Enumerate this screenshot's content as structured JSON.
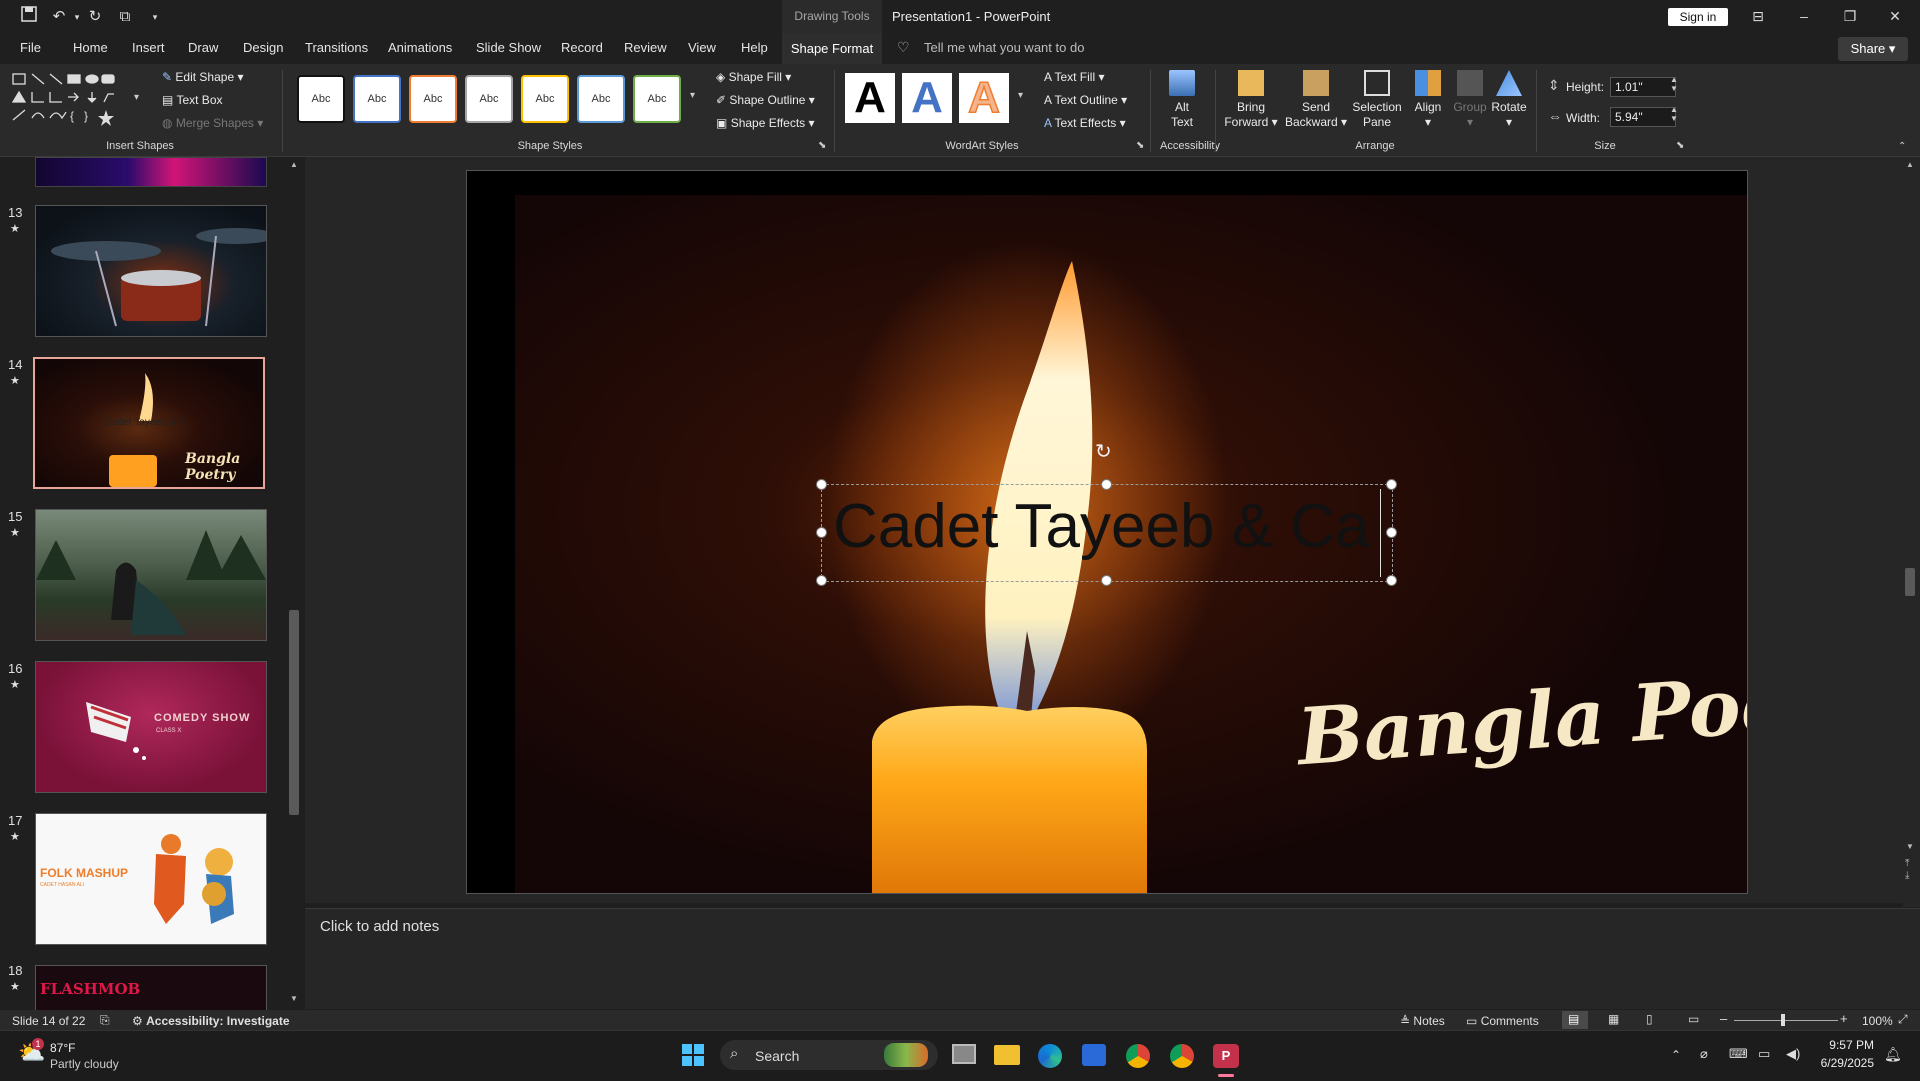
{
  "app": {
    "title": "Presentation1  -  PowerPoint",
    "drawing_tools": "Drawing Tools",
    "sign_in": "Sign in",
    "share": "Share"
  },
  "tabs": [
    "File",
    "Home",
    "Insert",
    "Draw",
    "Design",
    "Transitions",
    "Animations",
    "Slide Show",
    "Record",
    "Review",
    "View",
    "Help"
  ],
  "active_tab": "Shape Format",
  "tell_me": "Tell me what you want to do",
  "ribbon": {
    "insert_shapes": {
      "label": "Insert Shapes",
      "edit_shape": "Edit Shape",
      "text_box": "Text Box",
      "merge_shapes": "Merge Shapes"
    },
    "shape_styles": {
      "label": "Shape Styles",
      "swatch": "Abc",
      "fill": "Shape Fill",
      "outline": "Shape Outline",
      "effects": "Shape Effects"
    },
    "wordart": {
      "label": "WordArt Styles",
      "letter": "A",
      "fill": "Text Fill",
      "outline": "Text Outline",
      "effects": "Text Effects"
    },
    "accessibility": {
      "label": "Accessibility",
      "alt_text_1": "Alt",
      "alt_text_2": "Text"
    },
    "arrange": {
      "label": "Arrange",
      "bring_1": "Bring",
      "bring_2": "Forward",
      "send_1": "Send",
      "send_2": "Backward",
      "sel_1": "Selection",
      "sel_2": "Pane",
      "align": "Align",
      "group": "Group",
      "rotate": "Rotate"
    },
    "size": {
      "label": "Size",
      "height_label": "Height:",
      "height": "1.01\"",
      "width_label": "Width:",
      "width": "5.94\""
    }
  },
  "slides": [
    {
      "num": "13",
      "star": "★"
    },
    {
      "num": "14",
      "star": "★",
      "title": "Cadet Tayeeb & C",
      "sub": "Bangla Poetry"
    },
    {
      "num": "15",
      "star": "★"
    },
    {
      "num": "16",
      "star": "★",
      "title": "COMEDY SHOW",
      "sub": "CLASS X"
    },
    {
      "num": "17",
      "star": "★",
      "title": "FOLK MASHUP",
      "sub": "CADET HASAN ALI"
    },
    {
      "num": "18",
      "star": "★",
      "title": "FLASHMOB"
    }
  ],
  "slide": {
    "text_box": "Cadet Tayeeb & Ca",
    "script_title": "Bangla Poetry"
  },
  "notes_placeholder": "Click to add notes",
  "status": {
    "slide_of": "Slide 14 of 22",
    "accessibility": "Accessibility: Investigate",
    "notes": "Notes",
    "comments": "Comments",
    "zoom": "100%"
  },
  "taskbar": {
    "temp": "87°F",
    "weather": "Partly cloudy",
    "badge": "1",
    "search": "Search",
    "time": "9:57 PM",
    "date": "6/29/2025"
  },
  "colors": {
    "accent": "#c4314b",
    "ribbon": "#2a2a2a",
    "selected_thumb": "#e8a59a"
  }
}
